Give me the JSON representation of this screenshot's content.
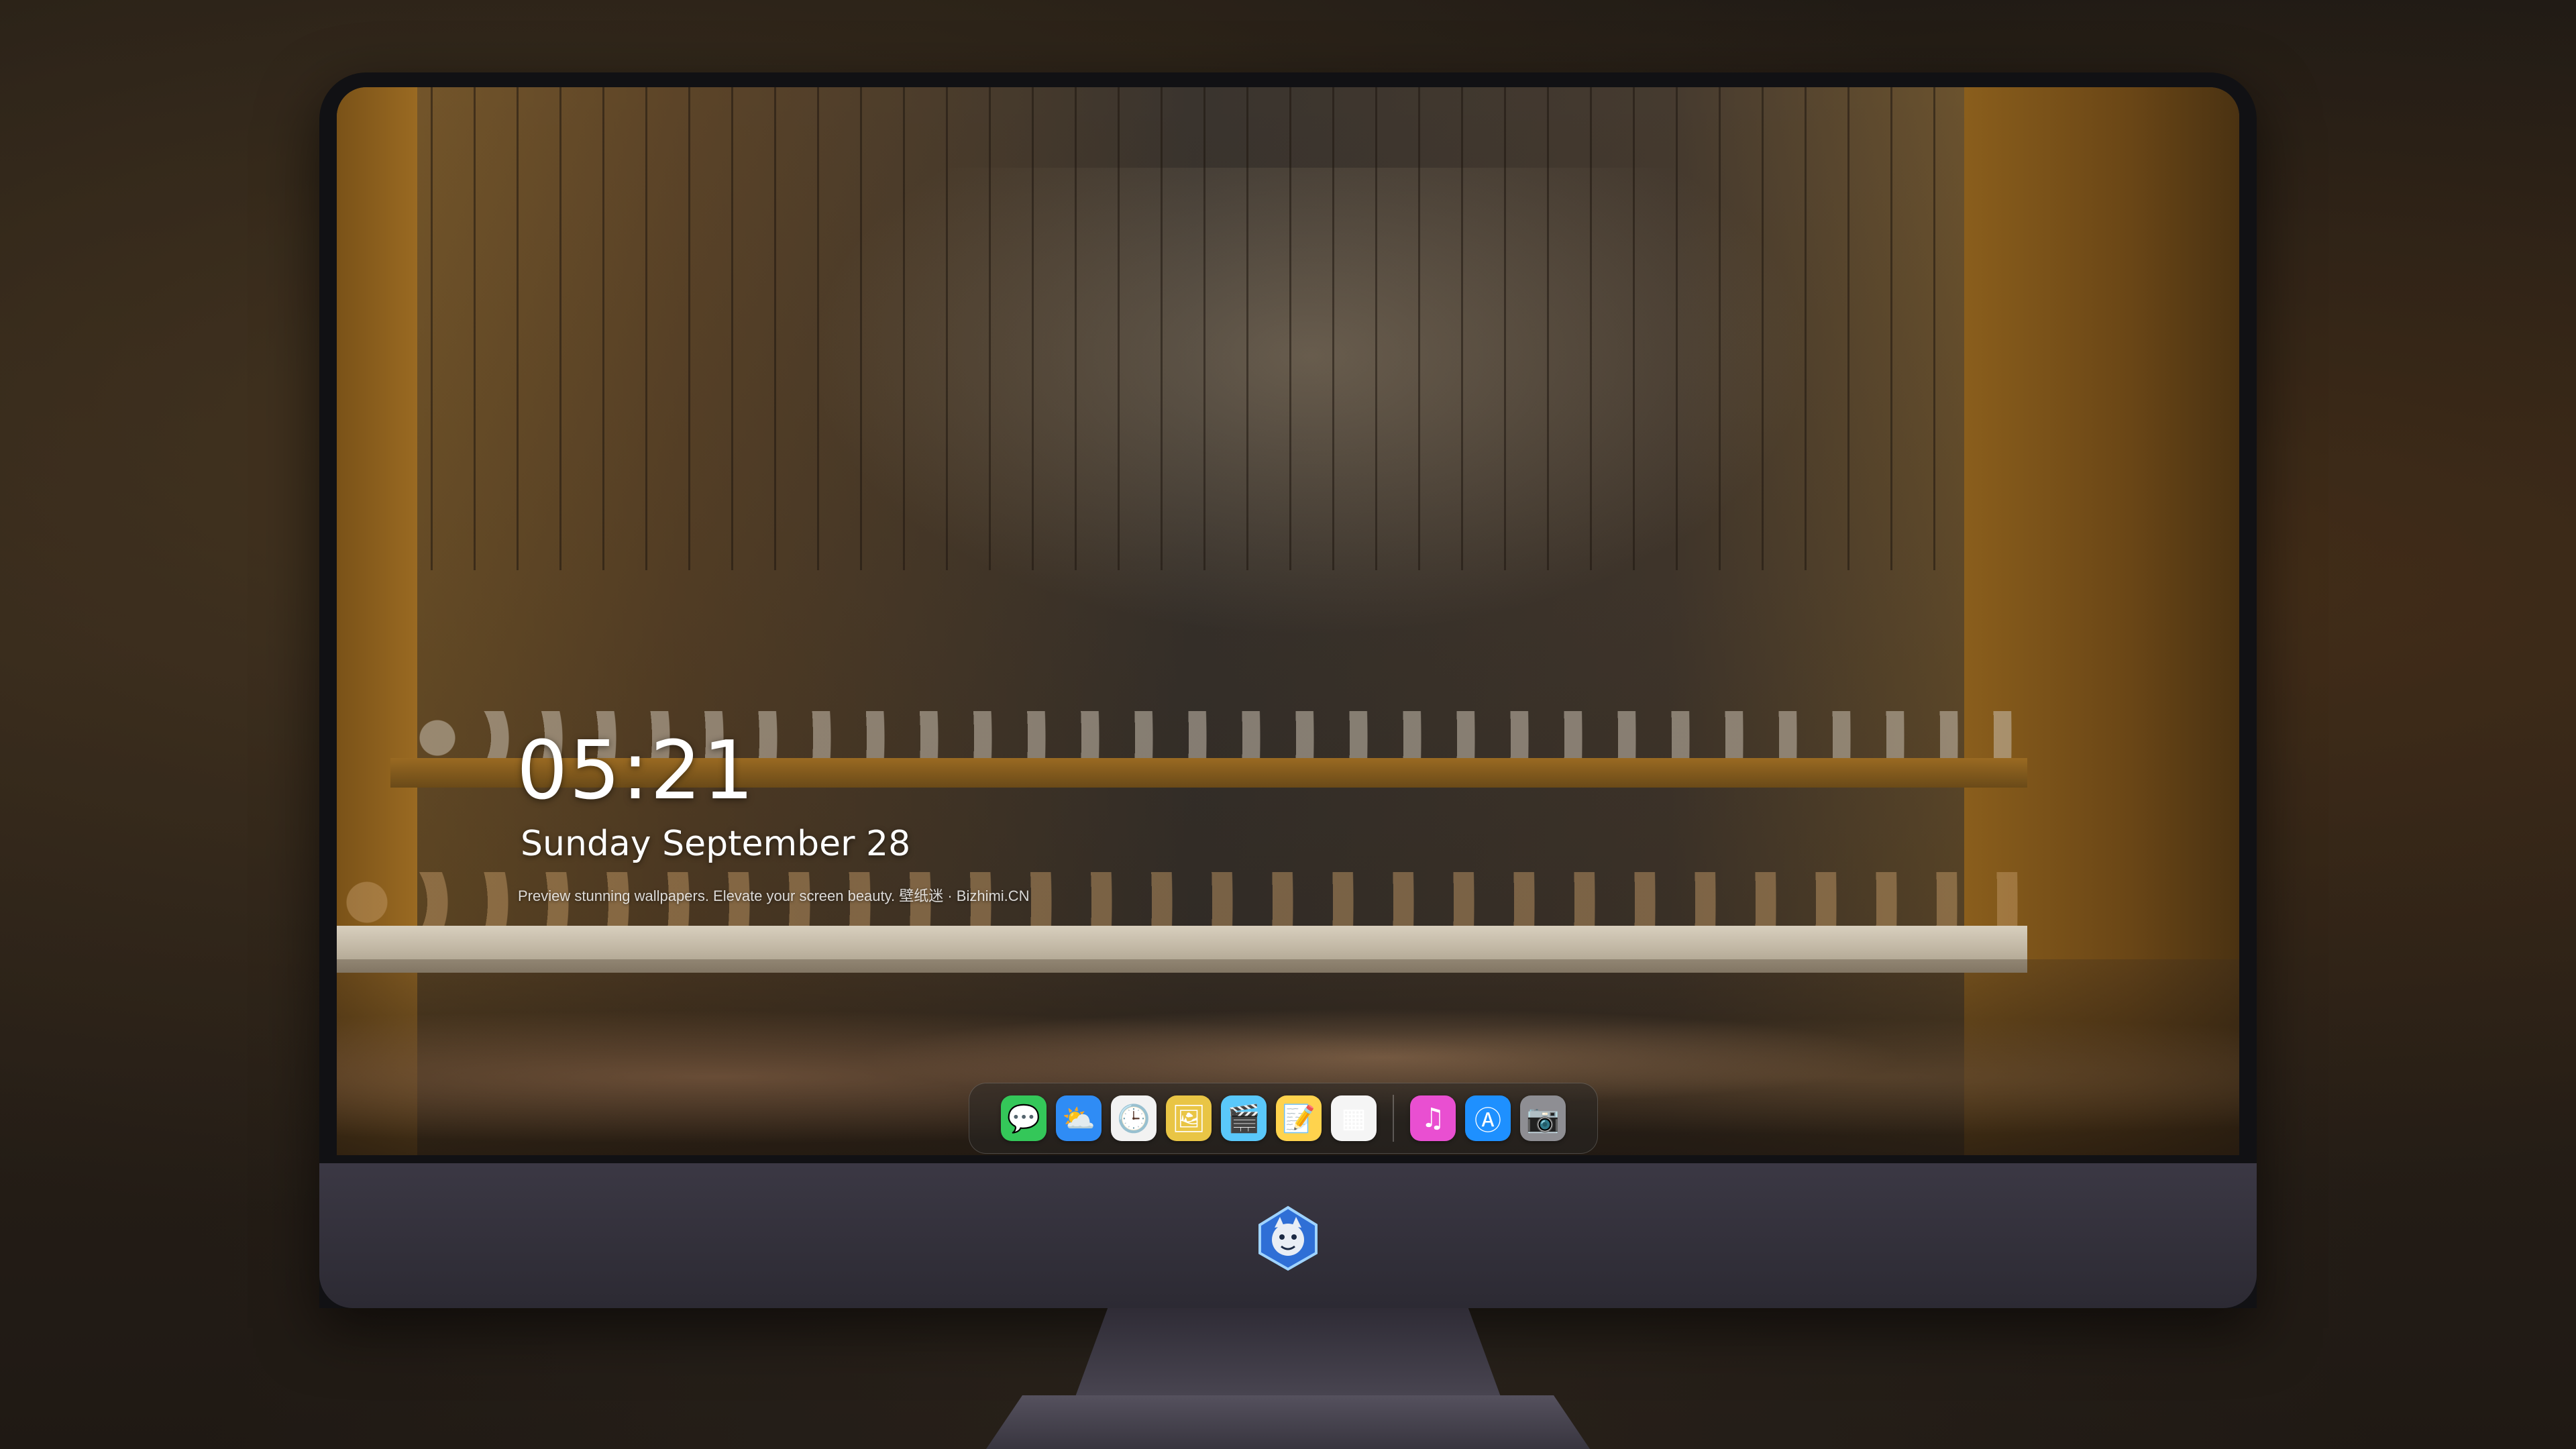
{
  "lockscreen": {
    "time": "05:21",
    "date": "Sunday September  28",
    "caption": "Preview stunning wallpapers. Elevate your screen beauty. 壁纸迷 · Bizhimi.CN"
  },
  "dock": {
    "apps": [
      {
        "name": "Messages",
        "icon": "message-bubble-icon",
        "glyph": "💬",
        "color": "#34c759"
      },
      {
        "name": "Weather",
        "icon": "weather-cloud-icon",
        "glyph": "⛅",
        "color": "#2f8cf5"
      },
      {
        "name": "Clock",
        "icon": "clock-icon",
        "glyph": "🕒",
        "color": "#f2f2f2"
      },
      {
        "name": "Preview",
        "icon": "preview-icon",
        "glyph": "🖼",
        "color": "#e9c545"
      },
      {
        "name": "Clips",
        "icon": "clapperboard-icon",
        "glyph": "🎬",
        "color": "#5ac8fa"
      },
      {
        "name": "Notes",
        "icon": "notes-icon",
        "glyph": "📝",
        "color": "#ffd34d"
      },
      {
        "name": "Photos",
        "icon": "photos-grid-icon",
        "glyph": "▦",
        "color": "#f5f5f5"
      },
      {
        "name": "iTunes",
        "icon": "music-note-icon",
        "glyph": "♫",
        "color": "#e94fd1"
      },
      {
        "name": "App Store",
        "icon": "app-store-icon",
        "glyph": "Ⓐ",
        "color": "#1e90ff"
      },
      {
        "name": "Camera",
        "icon": "camera-icon",
        "glyph": "📷",
        "color": "#8e8e93"
      }
    ]
  }
}
